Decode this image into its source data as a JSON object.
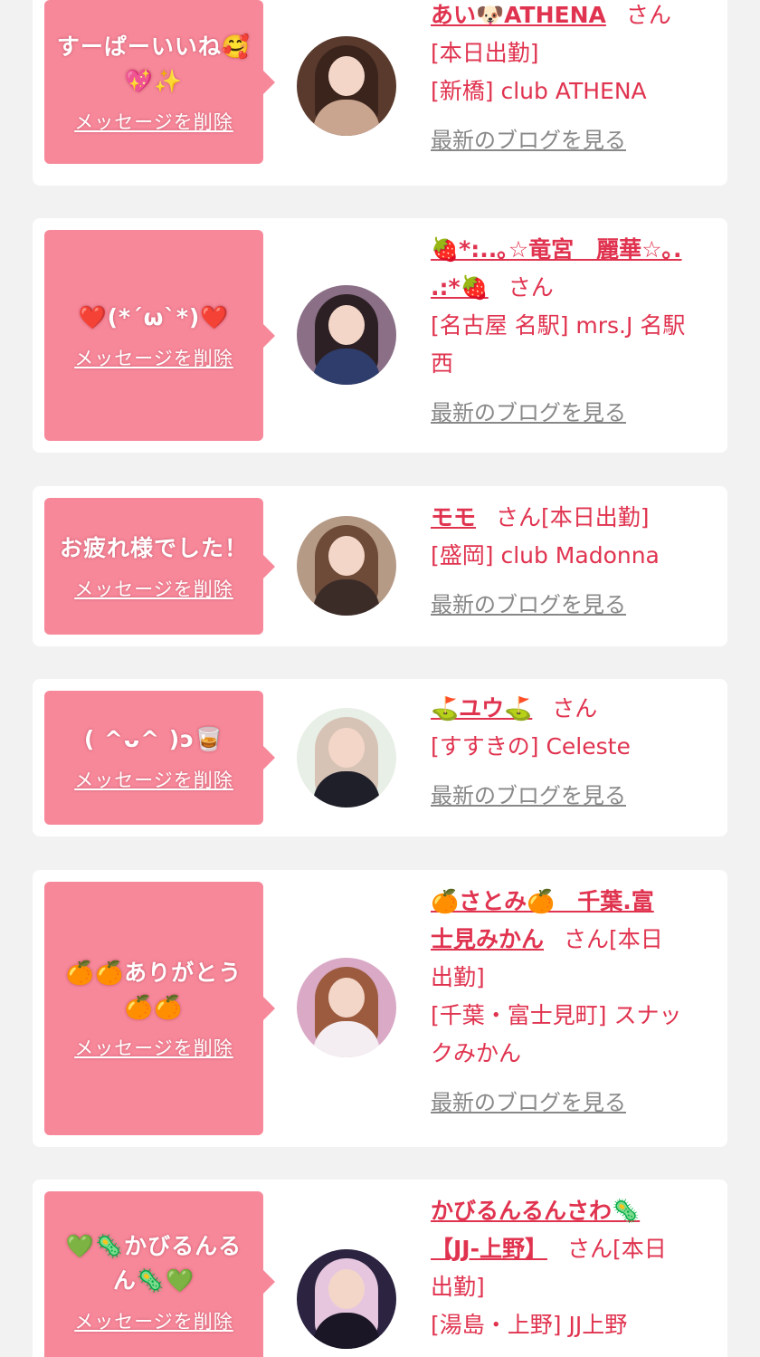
{
  "cards": [
    {
      "message": [
        "すーぱーいいね🥰",
        "💖✨"
      ],
      "delete_label": "メッセージを削除",
      "name_lines": [
        "あい🐶ATHENA"
      ],
      "san": "さん",
      "status": "[本日出勤]",
      "shop": "[新橋] club ATHENA",
      "blog_label": "最新のブログを見る"
    },
    {
      "message": [
        "❤️(*´ω`*)❤️"
      ],
      "delete_label": "メッセージを削除",
      "name_lines": [
        "🍓*:..｡☆竜宮　麗華☆｡.",
        ".:*🍓"
      ],
      "san": "さん",
      "shop_lines": [
        "[名古屋 名駅] mrs.J 名駅",
        "西"
      ],
      "blog_label": "最新のブログを見る"
    },
    {
      "message": [
        "お疲れ様でした！"
      ],
      "delete_label": "メッセージを削除",
      "name_lines": [
        "モモ"
      ],
      "san": "さん",
      "status": "[本日出勤]",
      "shop": "[盛岡] club Madonna",
      "blog_label": "最新のブログを見る"
    },
    {
      "message": [
        "( ^ᴗ^ )ɔ🥃"
      ],
      "delete_label": "メッセージを削除",
      "name_lines": [
        "⛳ユウ⛳"
      ],
      "san": "さん",
      "shop": "[すすきの] Celeste",
      "blog_label": "最新のブログを見る"
    },
    {
      "message": [
        "🍊🍊ありがとう",
        "🍊🍊"
      ],
      "delete_label": "メッセージを削除",
      "name_lines": [
        "🍊さとみ🍊　千葉.富",
        "士見みかん"
      ],
      "san": "さん",
      "status_lines": [
        "[本日",
        "出勤]"
      ],
      "shop_lines": [
        "[千葉・富士見町] スナッ",
        "クみかん"
      ],
      "blog_label": "最新のブログを見る"
    },
    {
      "message": [
        "💚🦠かびるんる",
        "ん🦠💚"
      ],
      "delete_label": "メッセージを削除",
      "name_lines": [
        "かびるんるんさわ🦠",
        "【JJ-上野】"
      ],
      "san": "さん",
      "status_lines": [
        "[本日",
        "出勤]"
      ],
      "shop": "[湯島・上野] JJ上野"
    }
  ],
  "colors": {
    "bubble": "#f7889a",
    "accent_text": "#e0334f",
    "muted_link": "#888888",
    "page_bg": "#f2f2f2"
  }
}
